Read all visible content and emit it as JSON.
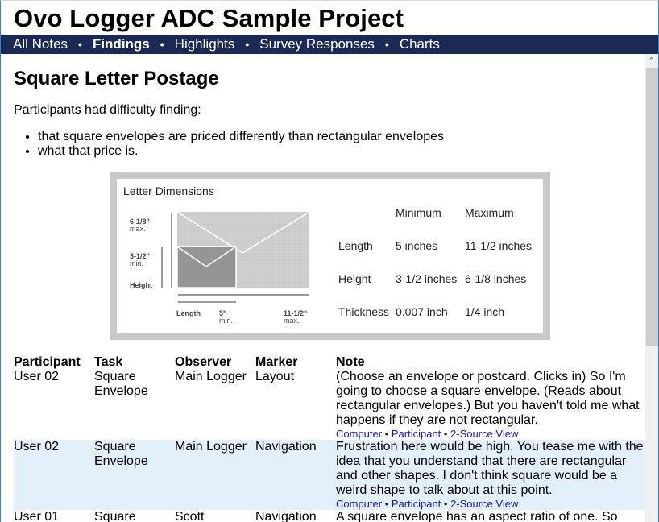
{
  "app": {
    "title": "Ovo Logger ADC Sample Project"
  },
  "nav": {
    "items": [
      {
        "label": "All Notes",
        "active": false
      },
      {
        "label": "Findings",
        "active": true
      },
      {
        "label": "Highlights",
        "active": false
      },
      {
        "label": "Survey Responses",
        "active": false
      },
      {
        "label": "Charts",
        "active": false
      }
    ],
    "separator": "•"
  },
  "finding": {
    "title": "Square Letter Postage",
    "intro": "Participants had difficulty finding:",
    "bullets": [
      "that square envelopes are priced differently than rectangular envelopes",
      "what that price is."
    ]
  },
  "figure": {
    "caption": "Letter Dimensions",
    "diagram_labels": {
      "max_height": "6-1/8\"",
      "max_height_sub": "max.",
      "min_height": "3-1/2\"",
      "min_height_sub": "min.",
      "height": "Height",
      "length": "Length",
      "min_length": "5\"",
      "min_length_sub": "min.",
      "max_length": "11-1/2\"",
      "max_length_sub": "max."
    },
    "table": {
      "headers": [
        "",
        "Minimum",
        "Maximum"
      ],
      "rows": [
        [
          "Length",
          "5 inches",
          "11-1/2 inches"
        ],
        [
          "Height",
          "3-1/2 inches",
          "6-1/8 inches"
        ],
        [
          "Thickness",
          "0.007 inch",
          "1/4 inch"
        ]
      ]
    }
  },
  "notes": {
    "headers": {
      "participant": "Participant",
      "task": "Task",
      "observer": "Observer",
      "marker": "Marker",
      "note": "Note"
    },
    "link_labels": [
      "Computer",
      "Participant",
      "2-Source View"
    ],
    "rows": [
      {
        "participant": "User 02",
        "task": "Square Envelope",
        "observer": "Main Logger",
        "marker": "Layout",
        "note": "(Choose an envelope or postcard. Clicks in) So I'm going to choose a square envelope. (Reads about rectangular envelopes.) But you haven't told me what happens if they are not rectangular."
      },
      {
        "participant": "User 02",
        "task": "Square Envelope",
        "observer": "Main Logger",
        "marker": "Navigation",
        "note": "Frustration here would be high. You tease me with the idea that you understand that there are rectangular and other shapes. I don't think square would be a weird shape to talk about at this point."
      },
      {
        "participant": "User 01",
        "task": "Square",
        "observer": "Scott",
        "marker": "Navigation",
        "note": "A square envelope has an aspect ratio of one. So"
      }
    ]
  },
  "scrollbar": {
    "up_arrow": "⌃"
  }
}
